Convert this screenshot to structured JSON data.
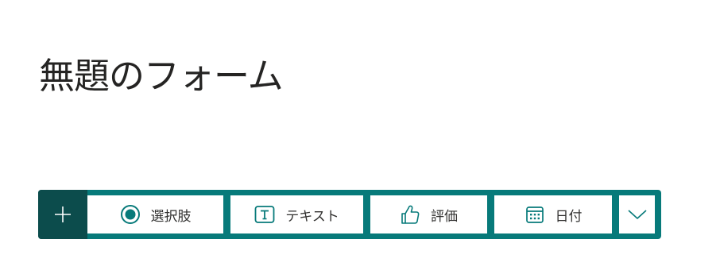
{
  "form": {
    "title": "無題のフォーム"
  },
  "question_bar": {
    "add_icon": "plus-icon",
    "buttons": [
      {
        "label": "選択肢",
        "icon": "radio-button-icon"
      },
      {
        "label": "テキスト",
        "icon": "text-box-icon"
      },
      {
        "label": "評価",
        "icon": "thumbs-up-icon"
      },
      {
        "label": "日付",
        "icon": "calendar-icon"
      }
    ],
    "more_icon": "chevron-down-icon"
  },
  "colors": {
    "bar_teal": "#077a7a",
    "add_button_dark_teal": "#0c4c4c",
    "icon_teal": "#077a7a",
    "title_text": "#252423"
  }
}
